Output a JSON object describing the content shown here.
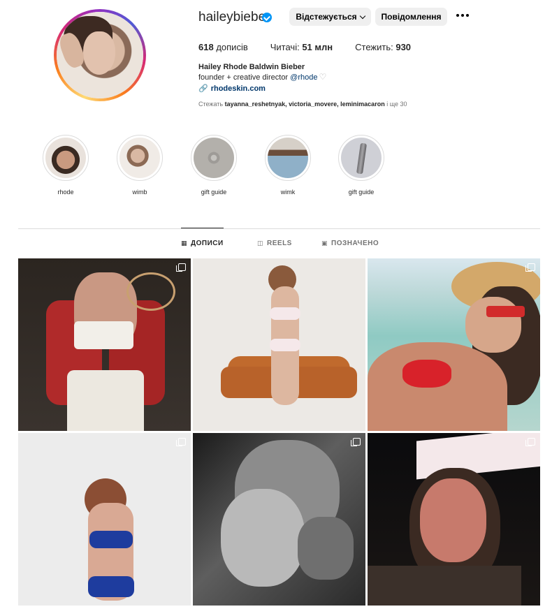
{
  "profile": {
    "username": "haileybieber",
    "follow_button": "Відстежується",
    "message_button": "Повідомлення",
    "stats": {
      "posts_value": "618",
      "posts_label": "дописів",
      "followers_label": "Читачі:",
      "followers_value": "51 млн",
      "following_label": "Стежить:",
      "following_value": "930"
    },
    "full_name": "Hailey Rhode Baldwin Bieber",
    "bio_text": "founder + creative director ",
    "bio_mention": "@rhode",
    "link_text": "rhodeskin.com",
    "followed_by_prefix": "Стежать ",
    "followed_by_names": "tayanna_reshetnyak, victoria_movere, leminimacaron",
    "followed_by_suffix": " і ще 30"
  },
  "highlights": [
    {
      "label": "rhode"
    },
    {
      "label": "wimb"
    },
    {
      "label": "gift guide"
    },
    {
      "label": "wimk"
    },
    {
      "label": "gift guide"
    }
  ],
  "tabs": [
    {
      "label": "ДОПИСИ",
      "icon": "grid-icon",
      "active": true
    },
    {
      "label": "REELS",
      "icon": "reels-icon",
      "active": false
    },
    {
      "label": "ПОЗНАЧЕНО",
      "icon": "tagged-icon",
      "active": false
    }
  ],
  "posts": [
    {
      "name": "post-tennis",
      "multi": true
    },
    {
      "name": "post-lingerie-sofa",
      "multi": false
    },
    {
      "name": "post-beach-cowboy-hat",
      "multi": true
    },
    {
      "name": "post-blue-bikini",
      "multi": true
    },
    {
      "name": "post-bw-kiss",
      "multi": true
    },
    {
      "name": "post-in-n-out-hat",
      "multi": true
    }
  ],
  "colors": {
    "verified": "#0095f6",
    "link": "#00376b",
    "button_bg": "#efefef"
  }
}
